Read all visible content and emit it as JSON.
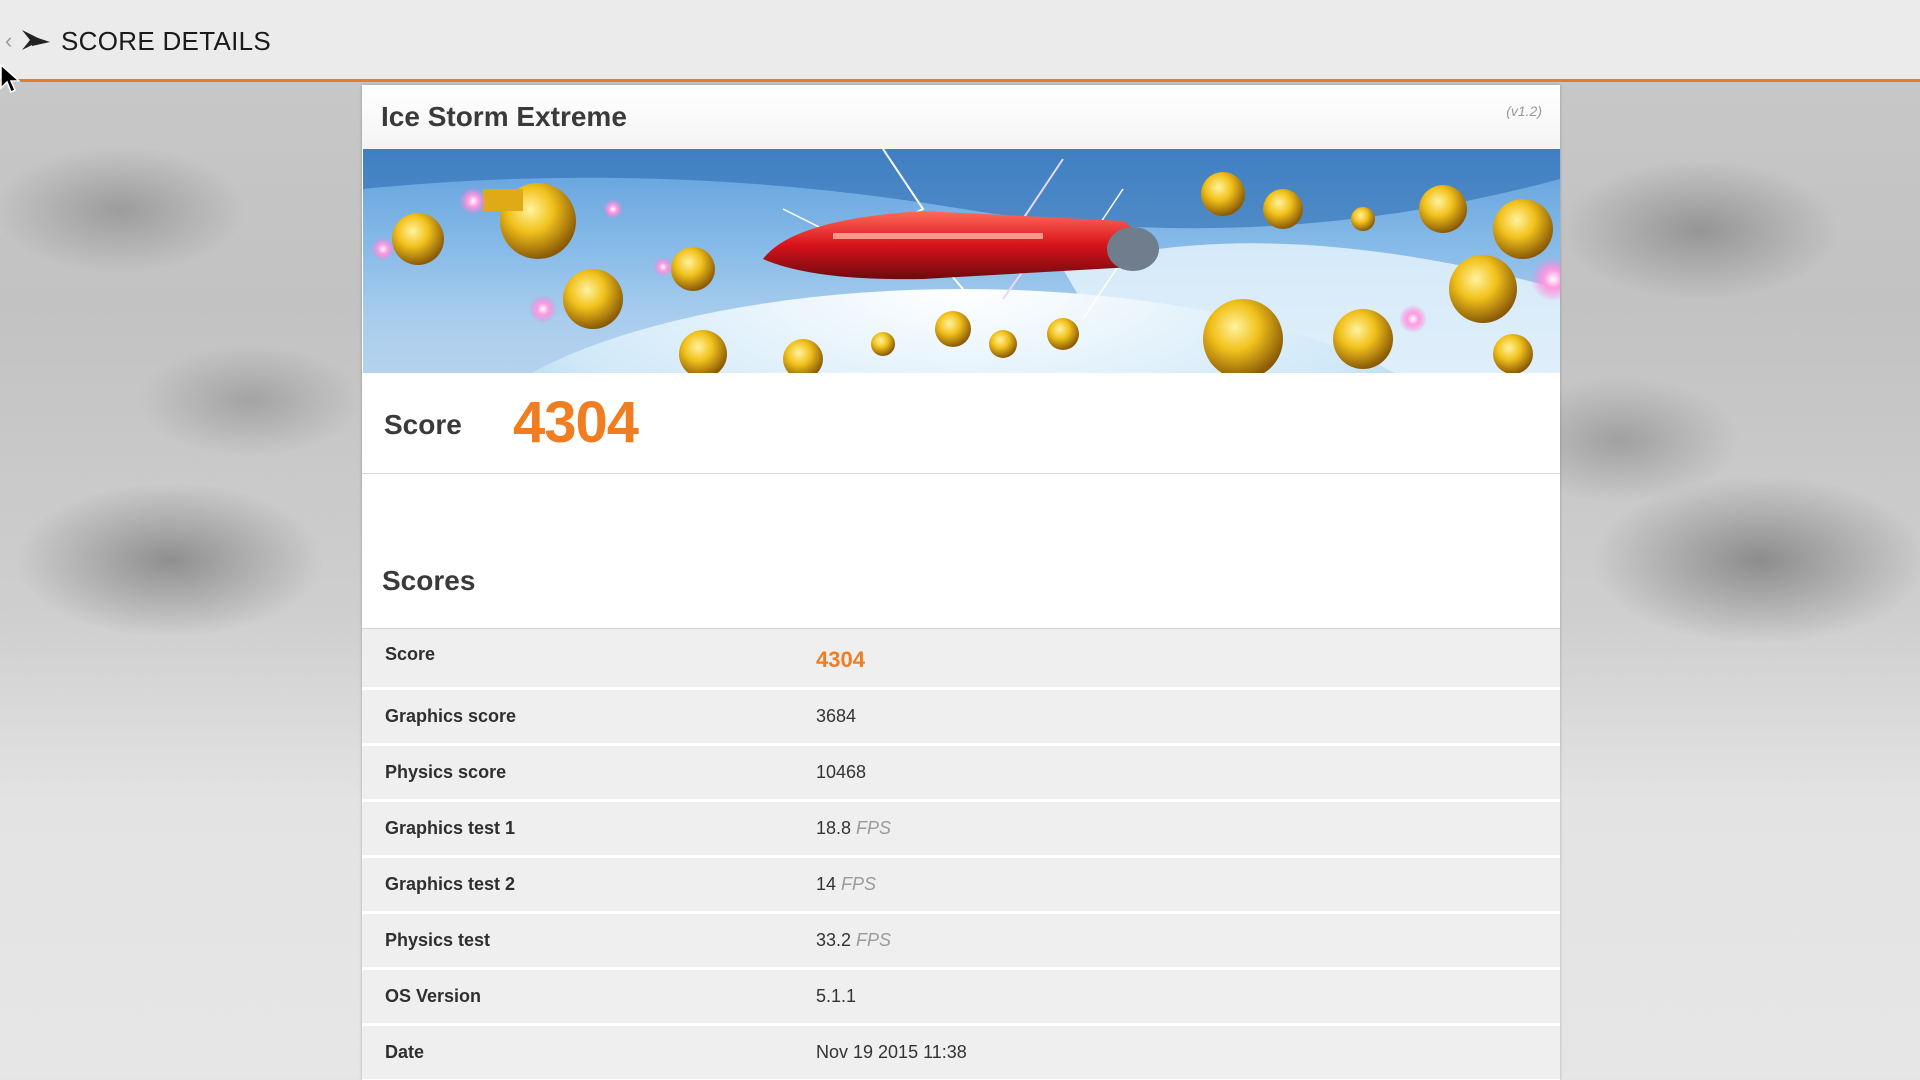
{
  "topbar": {
    "title": "SCORE DETAILS",
    "back_icon": "chevron-left-icon",
    "logo_icon": "3dmark-logo-icon",
    "accent": "#ec7a22"
  },
  "card": {
    "title": "Ice Storm Extreme",
    "version": "(v1.2)",
    "score_label": "Score",
    "score_value": "4304",
    "score_color": "#f07d22"
  },
  "scores": {
    "heading": "Scores",
    "rows": [
      {
        "label": "Score",
        "value": "4304",
        "unit": ""
      },
      {
        "label": "Graphics score",
        "value": "3684",
        "unit": ""
      },
      {
        "label": "Physics score",
        "value": "10468",
        "unit": ""
      },
      {
        "label": "Graphics test 1",
        "value": "18.8",
        "unit": "FPS"
      },
      {
        "label": "Graphics test 2",
        "value": "14",
        "unit": "FPS"
      },
      {
        "label": "Physics test",
        "value": "33.2",
        "unit": "FPS"
      },
      {
        "label": "OS Version",
        "value": "5.1.1",
        "unit": ""
      },
      {
        "label": "Date",
        "value": "Nov 19 2015 11:38",
        "unit": ""
      }
    ]
  }
}
